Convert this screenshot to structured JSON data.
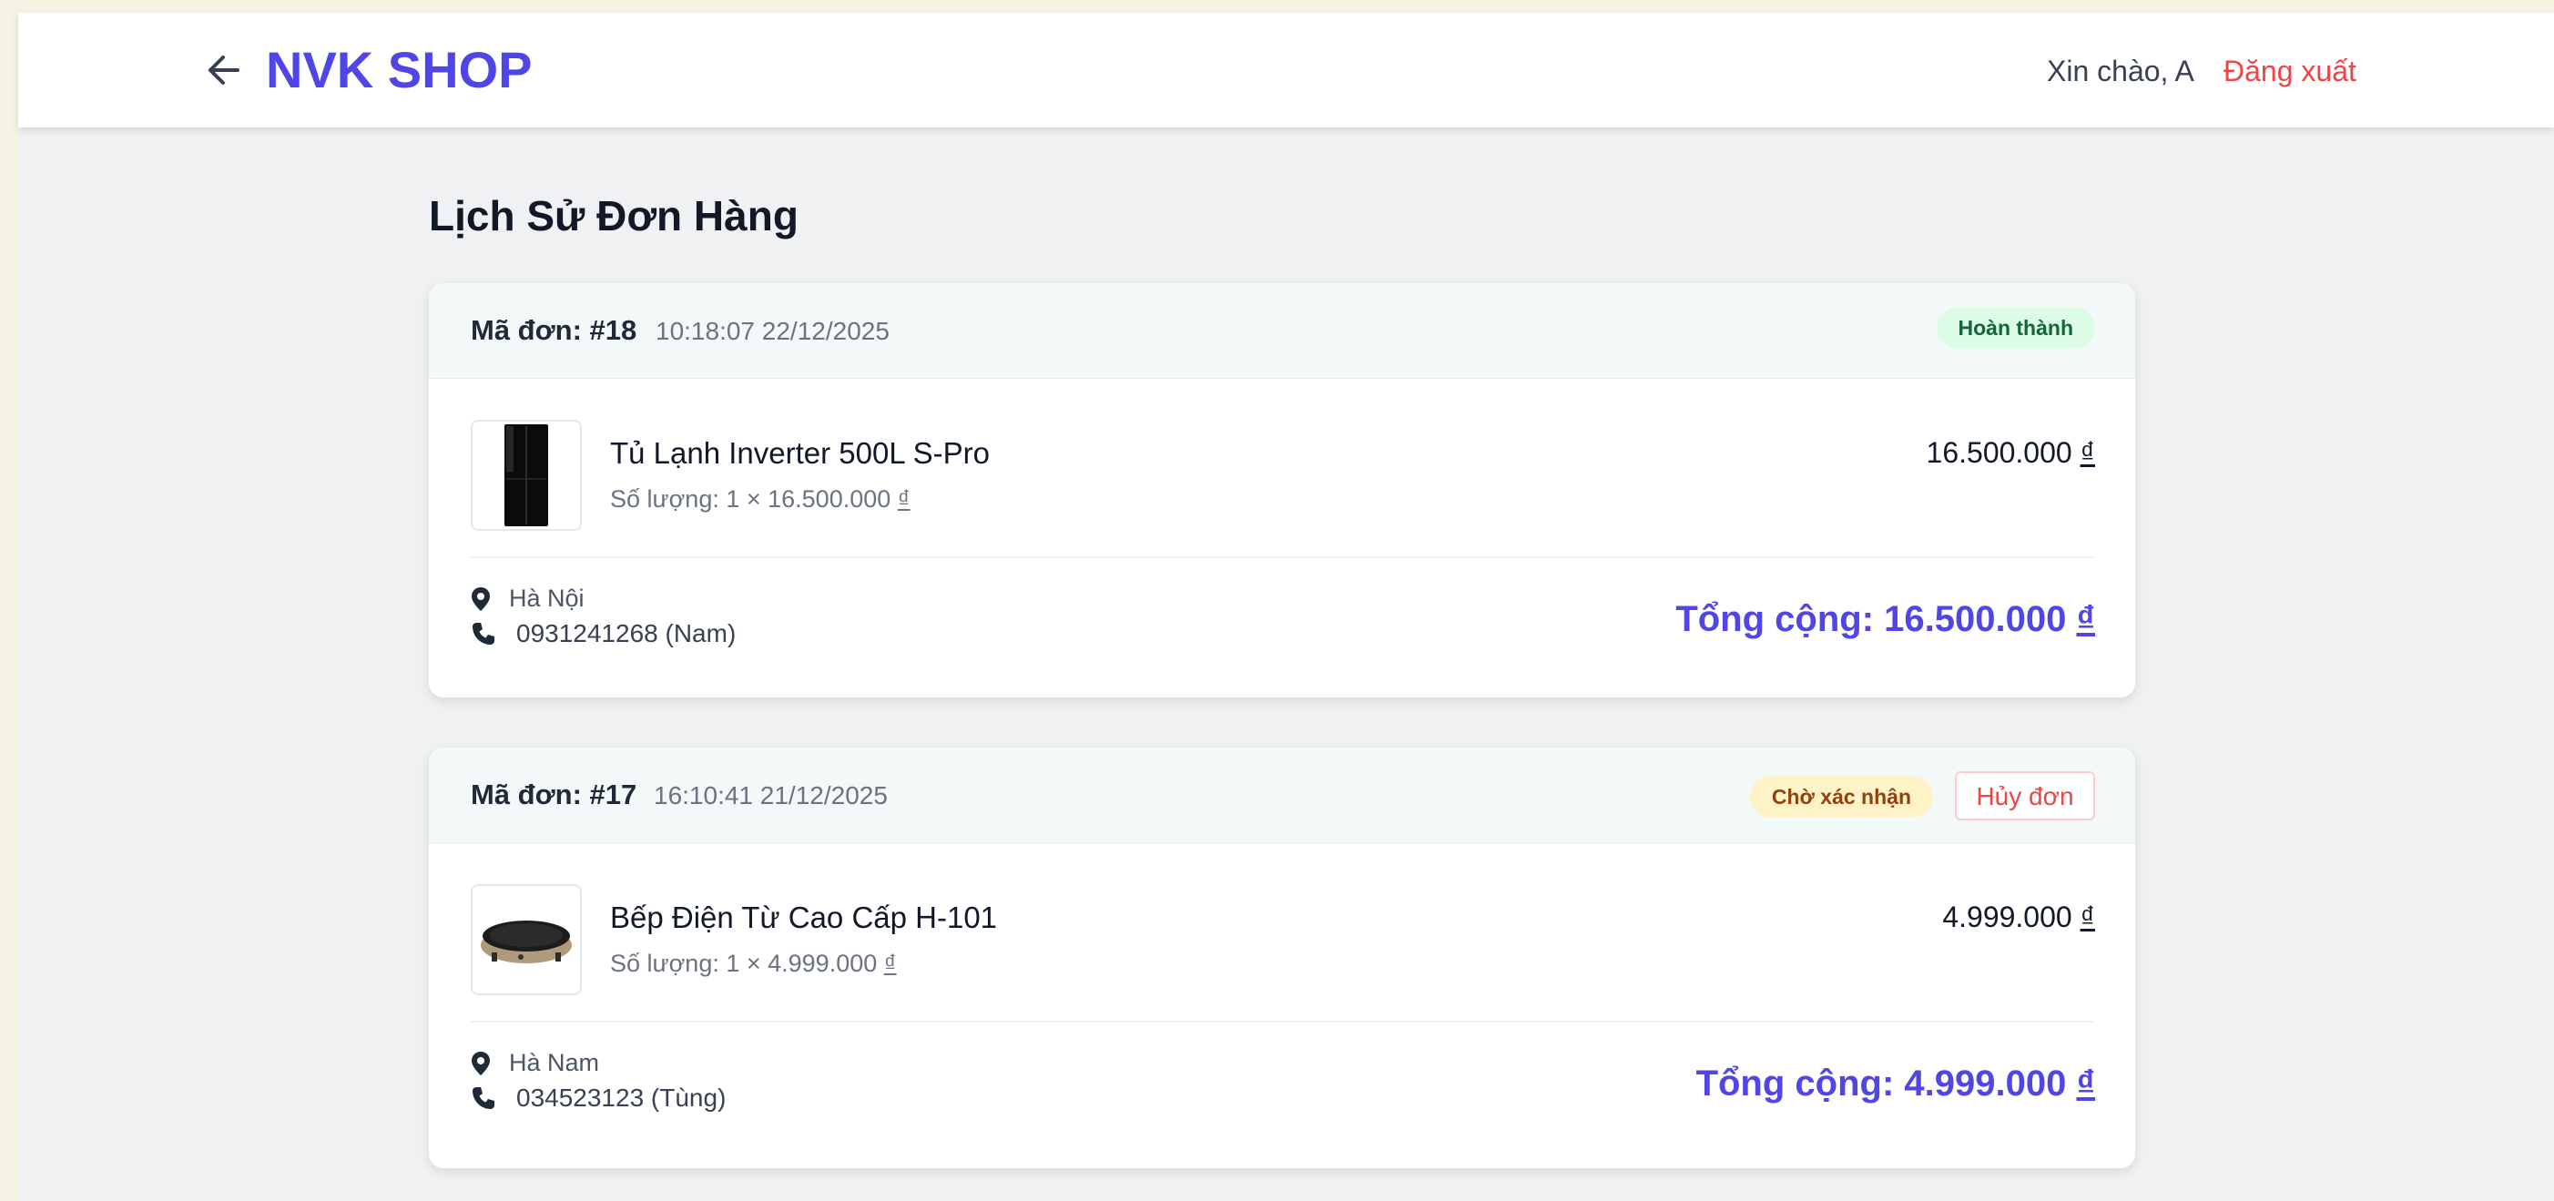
{
  "header": {
    "brand": "NVK SHOP",
    "greeting": "Xin chào, A",
    "logout_label": "Đăng xuất"
  },
  "page": {
    "title": "Lịch Sử Đơn Hàng"
  },
  "orders": [
    {
      "code": "Mã đơn: #18",
      "time": "10:18:07 22/12/2025",
      "status": "Hoàn thành",
      "item_name": "Tủ Lạnh Inverter 500L S-Pro",
      "item_qty": "Số lượng: 1 × 16.500.000",
      "item_price": "16.500.000",
      "address": "Hà Nội",
      "phone": "0931241268 (Nam)",
      "total": "Tổng cộng: 16.500.000"
    },
    {
      "code": "Mã đơn: #17",
      "time": "16:10:41 21/12/2025",
      "status": "Chờ xác nhận",
      "cancel_label": "Hủy đơn",
      "item_name": "Bếp Điện Từ Cao Cấp H-101",
      "item_qty": "Số lượng: 1 × 4.999.000",
      "item_price": "4.999.000",
      "address": "Hà Nam",
      "phone": "034523123 (Tùng)",
      "total": "Tổng cộng: 4.999.000"
    }
  ],
  "currency_symbol": "₫",
  "colors": {
    "brand": "#4f46e5",
    "logout": "#ef4444",
    "status_done_bg": "#dcfce7",
    "status_pending_bg": "#fef3c7"
  },
  "icons": {
    "back": "arrow-left-icon",
    "address": "map-marker-icon",
    "phone": "phone-icon"
  }
}
